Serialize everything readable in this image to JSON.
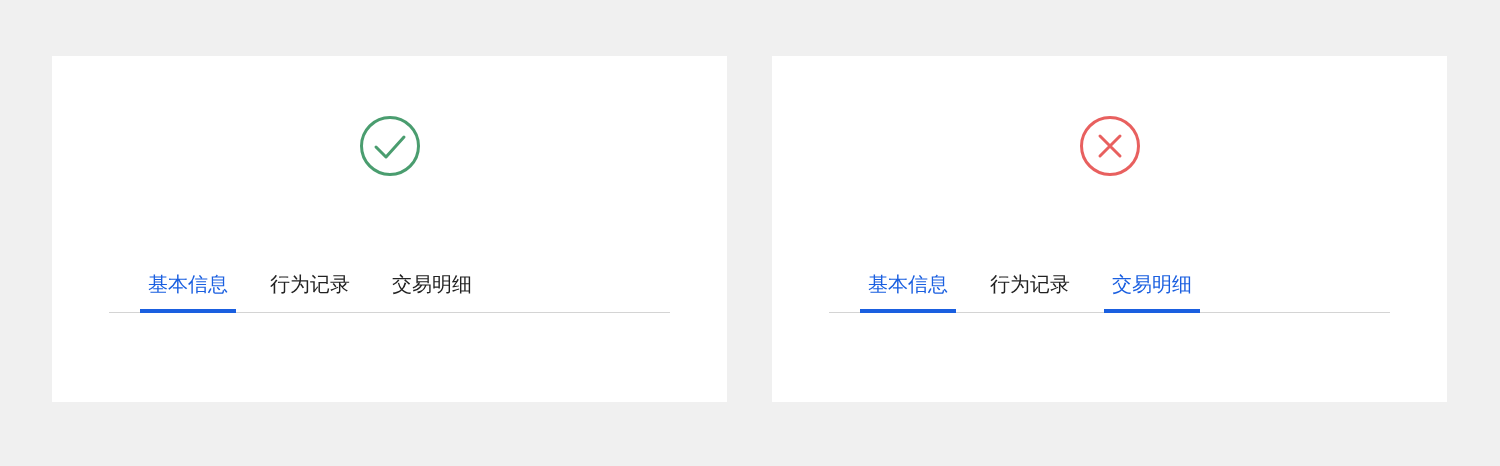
{
  "panels": [
    {
      "kind": "correct",
      "tabs": [
        {
          "label": "基本信息",
          "selected": true
        },
        {
          "label": "行为记录",
          "selected": false
        },
        {
          "label": "交易明细",
          "selected": false
        }
      ]
    },
    {
      "kind": "incorrect",
      "tabs": [
        {
          "label": "基本信息",
          "selected": true
        },
        {
          "label": "行为记录",
          "selected": false
        },
        {
          "label": "交易明细",
          "selected": true
        }
      ]
    }
  ]
}
